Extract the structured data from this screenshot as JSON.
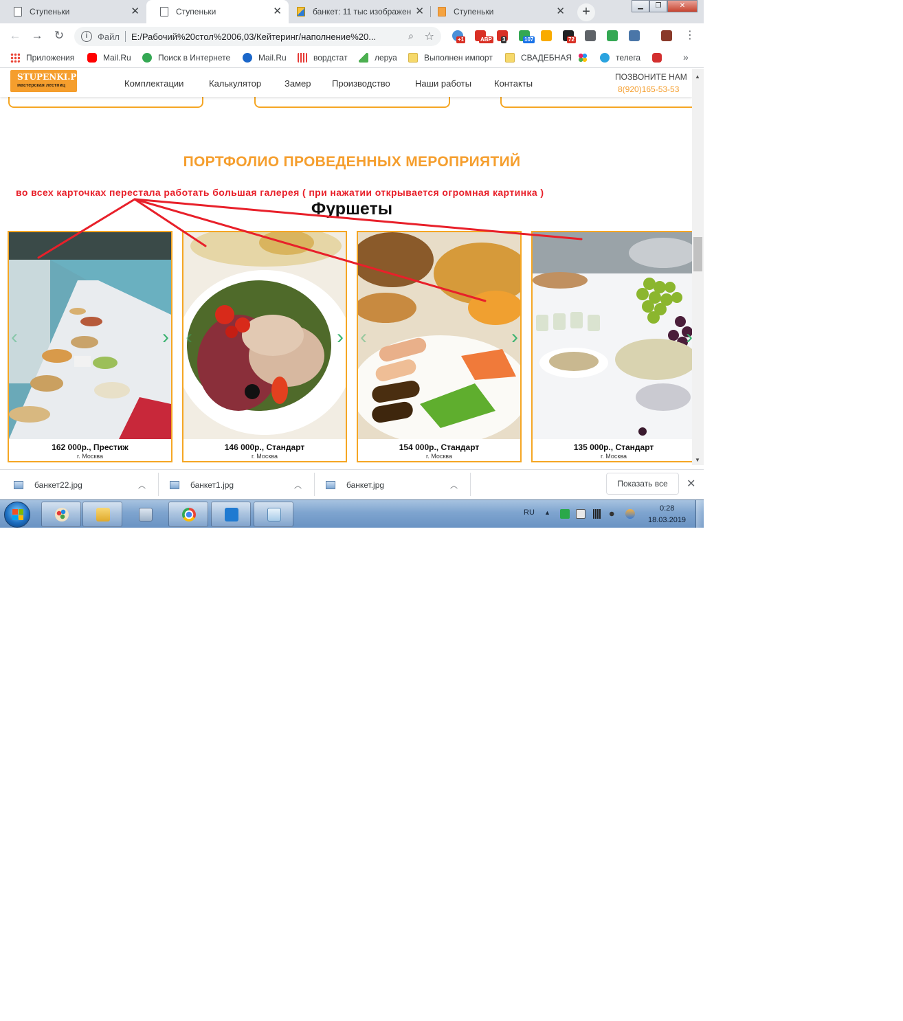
{
  "browser": {
    "tabs": [
      {
        "title": "Ступеньки",
        "icon": "page-icon"
      },
      {
        "title": "Ступеньки",
        "icon": "page-icon"
      },
      {
        "title": "банкет: 11 тыс изображен",
        "icon": "image-search-icon"
      },
      {
        "title": "Ступеньки",
        "icon": "stupenki-favicon-icon"
      }
    ],
    "new_tab": "+",
    "window": {
      "minimize": "▁",
      "restore": "❐",
      "close": "✕"
    },
    "nav": {
      "back": "←",
      "forward": "→",
      "reload": "↻"
    },
    "address": {
      "scheme": "Файл",
      "url": "E:/Рабочий%20стол%2006,03/Кейтеринг/наполнение%20..."
    },
    "extensions": [
      {
        "name": "cloud-icon",
        "badge": "+1",
        "color": "#4a90d9",
        "badge_color": "#d93025"
      },
      {
        "name": "adblock-icon",
        "badge": "ABP",
        "color": "#d93025",
        "badge_color": "#d93025"
      },
      {
        "name": "opera-red-icon",
        "badge": "3",
        "color": "#d93025",
        "badge_color": "#333333"
      },
      {
        "name": "lock-icon",
        "badge": "107",
        "color": "#34a853",
        "badge_color": "#1a73e8"
      },
      {
        "name": "yandex-icon",
        "badge": "",
        "color": "#f9ab00",
        "badge_color": ""
      },
      {
        "name": "chat-icon",
        "badge": "72",
        "color": "#202124",
        "badge_color": "#d93025"
      },
      {
        "name": "camera-icon",
        "badge": "",
        "color": "#5f6368",
        "badge_color": ""
      },
      {
        "name": "green-circle-icon",
        "badge": "",
        "color": "#34a853",
        "badge_color": ""
      },
      {
        "name": "vk-icon",
        "badge": "",
        "color": "#4a76a8",
        "badge_color": ""
      },
      {
        "name": "pen-icon",
        "badge": "",
        "color": "#8a3a2a",
        "badge_color": ""
      }
    ],
    "menu": "⋮"
  },
  "bookmarks": {
    "items": [
      {
        "label": "Приложения",
        "icon": "apps-grid-icon",
        "color": "#ea4335"
      },
      {
        "label": "Mail.Ru",
        "icon": "youtube-icon",
        "color": "#ff0000"
      },
      {
        "label": "Поиск в Интернете",
        "icon": "ke-icon",
        "color": "#34a853"
      },
      {
        "label": "Mail.Ru",
        "icon": "mail-at-icon",
        "color": "#1a66c9"
      },
      {
        "label": "вордстат",
        "icon": "chart-bars-icon",
        "color": "#e53935"
      },
      {
        "label": "леруа",
        "icon": "leroy-icon",
        "color": "#4caf50"
      },
      {
        "label": "Выполнен импорт",
        "icon": "folder-icon",
        "color": "#f6d96b"
      },
      {
        "label": "СВАДЕБНАЯ",
        "icon": "folder-icon",
        "color": "#f6d96b"
      },
      {
        "label": "",
        "icon": "dots-color-icon",
        "color": "#e91e63"
      },
      {
        "label": "телега",
        "icon": "telegram-icon",
        "color": "#2aa3df"
      },
      {
        "label": "",
        "icon": "mask-icon",
        "color": "#d32f2f"
      }
    ],
    "more": "»"
  },
  "site": {
    "logo": {
      "line1": "STUPENKI.PRO",
      "line2": "мастерская лестниц"
    },
    "nav": [
      "Комплектации",
      "Калькулятор",
      "Замер",
      "Производство",
      "Наши работы",
      "Контакты"
    ],
    "call_label": "ПОЗВОНИТЕ НАМ",
    "phone": "8(920)165-53-53",
    "accent": "#f59e2d"
  },
  "content": {
    "portfolio_title": "ПОРТФОЛИО ПРОВЕДЕННЫХ МЕРОПРИЯТИЙ",
    "annotation": "во всех карточках перестала работать большая галерея ( при нажатии открывается огромная картинка )",
    "section_title": "Фуршеты",
    "cards": [
      {
        "price": "162 000р., Престиж",
        "city": "г. Москва",
        "photo": "banquet-hall-photo"
      },
      {
        "price": "146 000р., Стандарт",
        "city": "г. Москва",
        "photo": "meat-plate-photo"
      },
      {
        "price": "154 000р., Стандарт",
        "city": "г. Москва",
        "photo": "rolls-plate-photo"
      },
      {
        "price": "135 000р., Стандарт",
        "city": "г. Москва",
        "photo": "buffet-grapes-photo"
      }
    ],
    "prev_label": "‹",
    "next_label": "›"
  },
  "downloads": {
    "files": [
      "банкет22.jpg",
      "банкет1.jpg",
      "банкет.jpg"
    ],
    "show_all": "Показать все",
    "close": "✕"
  },
  "taskbar": {
    "apps": [
      "paint-icon",
      "explorer-icon",
      "calculator-icon",
      "chrome-icon",
      "vscode-icon",
      "notepad-icon"
    ],
    "lang": "RU",
    "time": "0:28",
    "date": "18.03.2019"
  }
}
